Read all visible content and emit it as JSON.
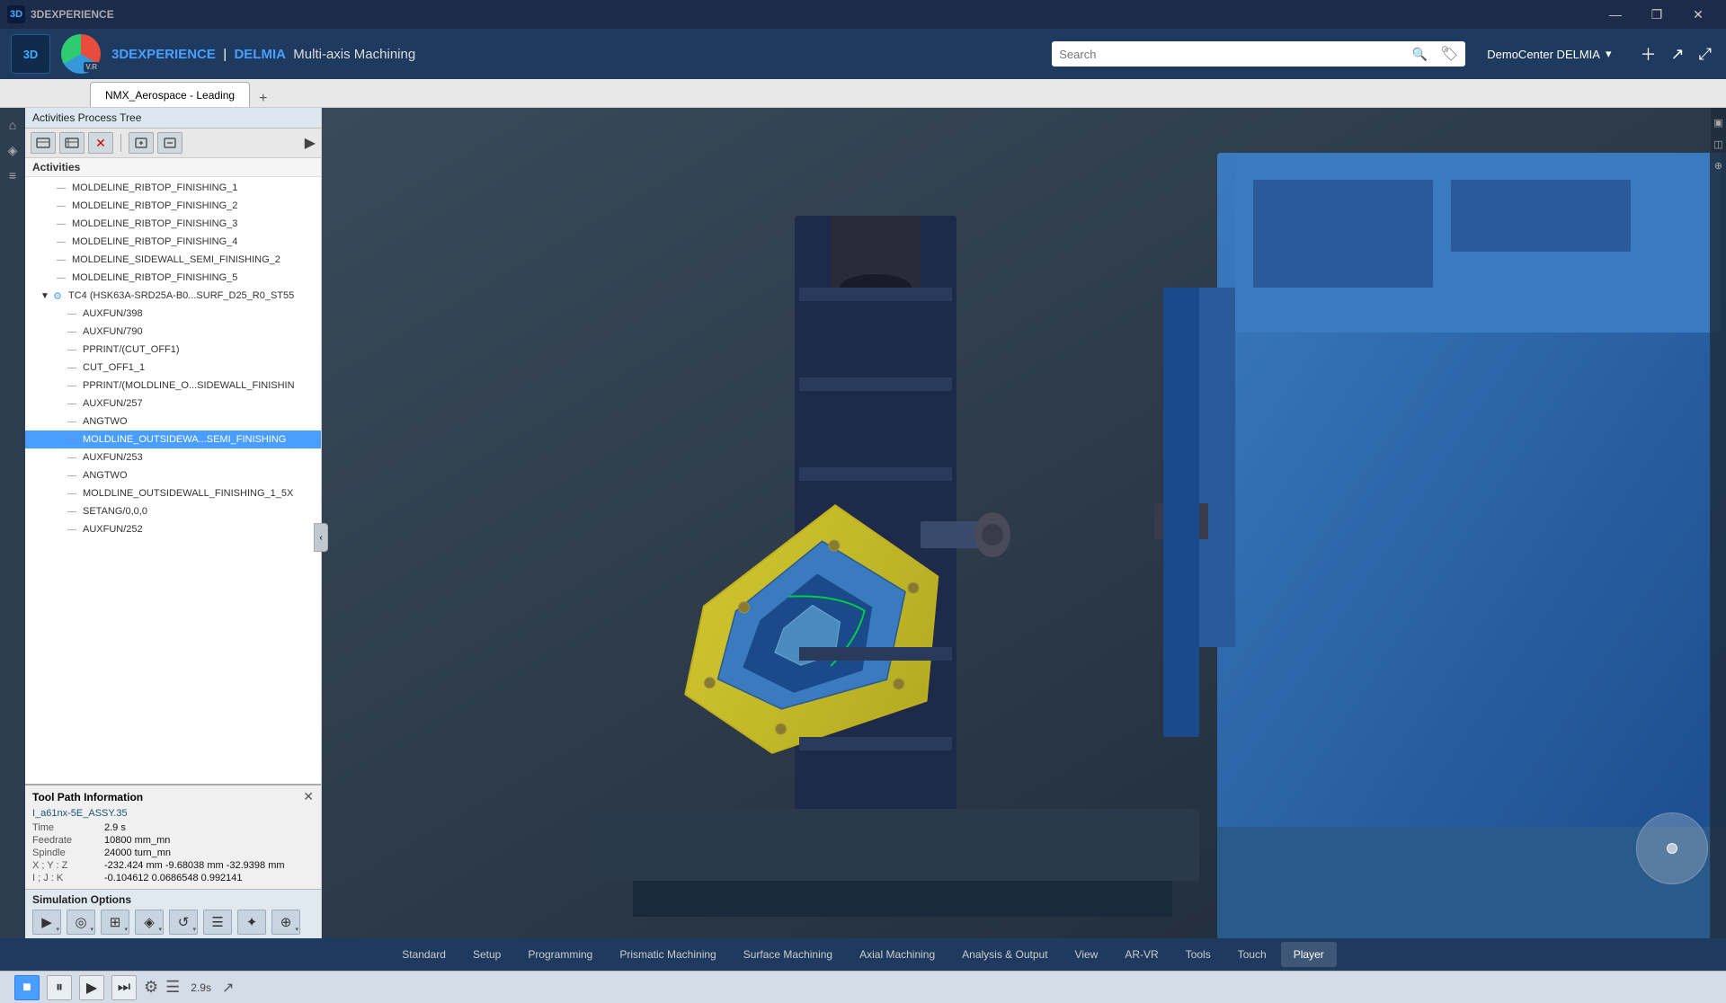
{
  "app": {
    "title": "3DEXPERIENCE",
    "brand": "DELMIA",
    "subtitle": "Multi-axis Machining",
    "version": "V.R",
    "window_title": "3DEXPERIENCE"
  },
  "title_bar": {
    "title": "3DEXPERIENCE",
    "minimize": "—",
    "maximize": "❐",
    "close": "✕"
  },
  "search": {
    "placeholder": "Search",
    "value": ""
  },
  "user": {
    "name": "DemoCenter DELMIA",
    "chevron": "▾"
  },
  "tab_bar": {
    "tabs": [
      {
        "label": "NMX_Aerospace - Leading",
        "active": true
      },
      {
        "label": "+",
        "active": false
      }
    ]
  },
  "panel": {
    "header": "Activities Process Tree",
    "toolbar_buttons": [
      "⬡",
      "⊡",
      "✕",
      "⊞",
      "⊟"
    ],
    "arrow": "▶"
  },
  "tree": {
    "section": "Activities",
    "items": [
      {
        "id": 1,
        "label": "MOLDELINE_RIBTOP_FINISHING_1",
        "indent": 2,
        "type": "op",
        "selected": false
      },
      {
        "id": 2,
        "label": "MOLDELINE_RIBTOP_FINISHING_2",
        "indent": 2,
        "type": "op",
        "selected": false
      },
      {
        "id": 3,
        "label": "MOLDELINE_RIBTOP_FINISHING_3",
        "indent": 2,
        "type": "op",
        "selected": false
      },
      {
        "id": 4,
        "label": "MOLDELINE_RIBTOP_FINISHING_4",
        "indent": 2,
        "type": "op",
        "selected": false
      },
      {
        "id": 5,
        "label": "MOLDELINE_SIDEWALL_SEMI_FINISHING_2",
        "indent": 2,
        "type": "op",
        "selected": false
      },
      {
        "id": 6,
        "label": "MOLDELINE_RIBTOP_FINISHING_5",
        "indent": 2,
        "type": "op",
        "selected": false
      },
      {
        "id": 7,
        "label": "TC4 (HSK63A-SRD25A-B0...SURF_D25_R0_ST55",
        "indent": 1,
        "type": "group",
        "selected": false,
        "expanded": true
      },
      {
        "id": 8,
        "label": "AUXFUN/398",
        "indent": 3,
        "type": "op",
        "selected": false
      },
      {
        "id": 9,
        "label": "AUXFUN/790",
        "indent": 3,
        "type": "op",
        "selected": false
      },
      {
        "id": 10,
        "label": "PPRINT/(CUT_OFF1)",
        "indent": 3,
        "type": "op",
        "selected": false
      },
      {
        "id": 11,
        "label": "CUT_OFF1_1",
        "indent": 3,
        "type": "op",
        "selected": false
      },
      {
        "id": 12,
        "label": "PPRINT/(MOLDLINE_O...SIDEWALL_FINISHIN",
        "indent": 3,
        "type": "op",
        "selected": false
      },
      {
        "id": 13,
        "label": "AUXFUN/257",
        "indent": 3,
        "type": "op",
        "selected": false
      },
      {
        "id": 14,
        "label": "ANGTWO",
        "indent": 3,
        "type": "op",
        "selected": false
      },
      {
        "id": 15,
        "label": "MOLDLINE_OUTSIDEWA...SEMI_FINISHING",
        "indent": 3,
        "type": "op",
        "selected": true
      },
      {
        "id": 16,
        "label": "AUXFUN/253",
        "indent": 3,
        "type": "op",
        "selected": false
      },
      {
        "id": 17,
        "label": "ANGTWO",
        "indent": 3,
        "type": "op",
        "selected": false
      },
      {
        "id": 18,
        "label": "MOLDLINE_OUTSIDEWALL_FINISHING_1_5X",
        "indent": 3,
        "type": "op",
        "selected": false
      },
      {
        "id": 19,
        "label": "SETANG/0,0,0",
        "indent": 3,
        "type": "op",
        "selected": false
      },
      {
        "id": 20,
        "label": "AUXFUN/252",
        "indent": 3,
        "type": "op",
        "selected": false
      }
    ]
  },
  "tool_path_info": {
    "title": "Tool Path Information",
    "part_name": "I_a61nx-5E_ASSY.35",
    "rows": [
      {
        "label": "Time",
        "value": "2.9 s"
      },
      {
        "label": "Feedrate",
        "value": "10800 mm_mn"
      },
      {
        "label": "Spindle",
        "value": "24000 turn_mn"
      },
      {
        "label": "X ; Y : Z",
        "value": "-232.424 mm  -9.68038 mm  -32.9398 mm"
      },
      {
        "label": "I ; J : K",
        "value": "-0.104612  0.0686548  0.992141"
      }
    ]
  },
  "sim_options": {
    "title": "Simulation Options",
    "tools": [
      {
        "icon": "▶⊡",
        "name": "play-tool"
      },
      {
        "icon": "◎",
        "name": "eye-tool"
      },
      {
        "icon": "⊞",
        "name": "grid-tool"
      },
      {
        "icon": "◈",
        "name": "target-tool"
      },
      {
        "icon": "↺",
        "name": "undo-tool"
      },
      {
        "icon": "⊟",
        "name": "list-tool"
      },
      {
        "icon": "✦",
        "name": "star-tool"
      },
      {
        "icon": "⊕",
        "name": "plus-tool"
      }
    ]
  },
  "bottom_menu": {
    "tabs": [
      {
        "label": "Standard",
        "active": false
      },
      {
        "label": "Setup",
        "active": false
      },
      {
        "label": "Programming",
        "active": false
      },
      {
        "label": "Prismatic Machining",
        "active": false
      },
      {
        "label": "Surface Machining",
        "active": false
      },
      {
        "label": "Axial Machining",
        "active": false
      },
      {
        "label": "Analysis & Output",
        "active": false
      },
      {
        "label": "View",
        "active": false
      },
      {
        "label": "AR-VR",
        "active": false
      },
      {
        "label": "Tools",
        "active": false
      },
      {
        "label": "Touch",
        "active": false
      },
      {
        "label": "Player",
        "active": true
      }
    ]
  },
  "player": {
    "stop_label": "■",
    "pause_label": "⏸",
    "play_label": "▶",
    "forward_label": "⏭",
    "time": "2.9s"
  }
}
